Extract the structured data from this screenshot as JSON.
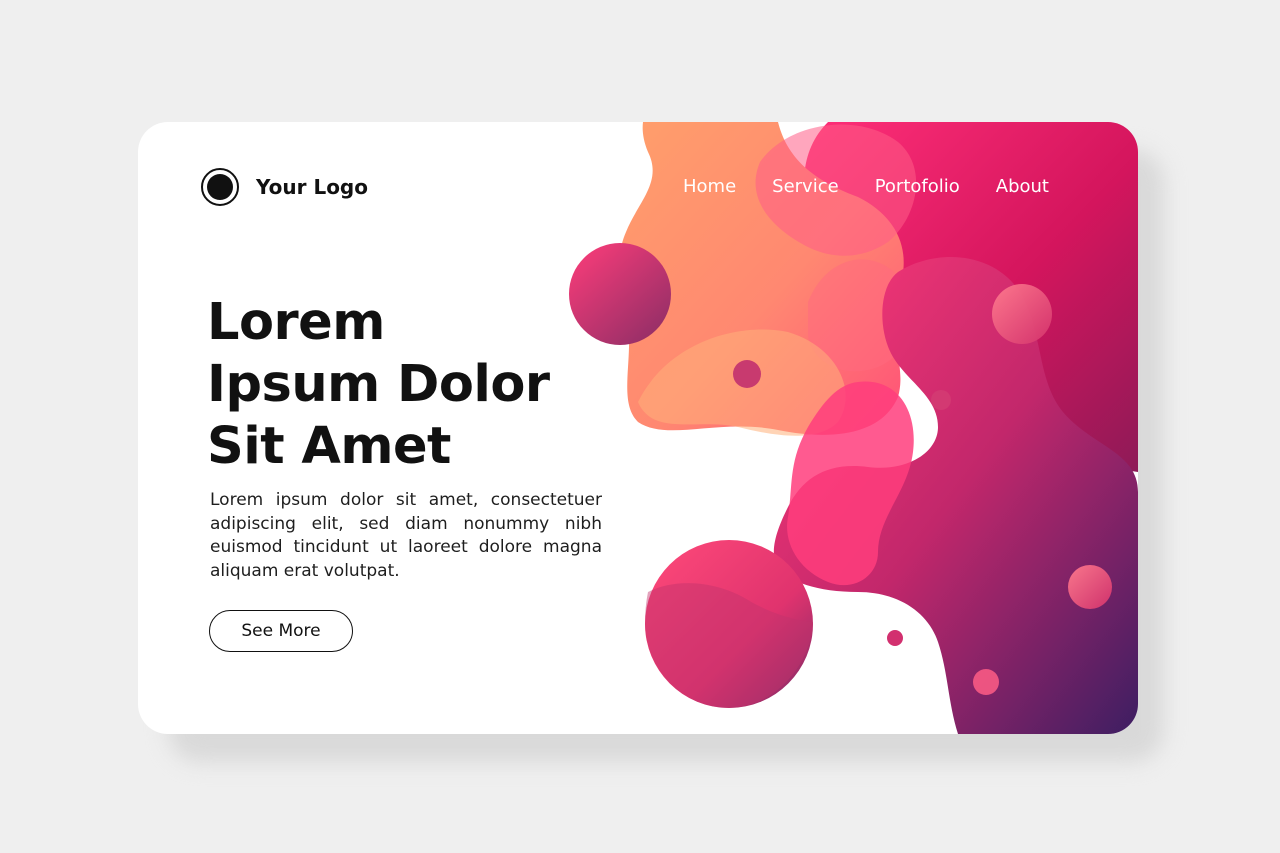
{
  "brand": {
    "logo_text": "Your Logo"
  },
  "nav": {
    "items": [
      {
        "label": "Home"
      },
      {
        "label": "Service"
      },
      {
        "label": "Portofolio"
      },
      {
        "label": "About"
      }
    ]
  },
  "hero": {
    "title_lines": [
      "Lorem",
      "Ipsum Dolor",
      "Sit Amet"
    ],
    "body": "Lorem ipsum dolor sit amet, consectetuer adipiscing elit, sed diam nonummy nibh euismod tincidunt ut laoreet dolore magna aliquam erat volutpat.",
    "cta_label": "See More"
  },
  "colors": {
    "background": "#efefef",
    "card": "#ffffff",
    "text": "#111111",
    "nav_text": "#ffffff",
    "gradient_orange": "#ffa46b",
    "gradient_pink": "#ff2f78",
    "gradient_magenta": "#d4155d",
    "gradient_purple": "#3d1e62"
  }
}
